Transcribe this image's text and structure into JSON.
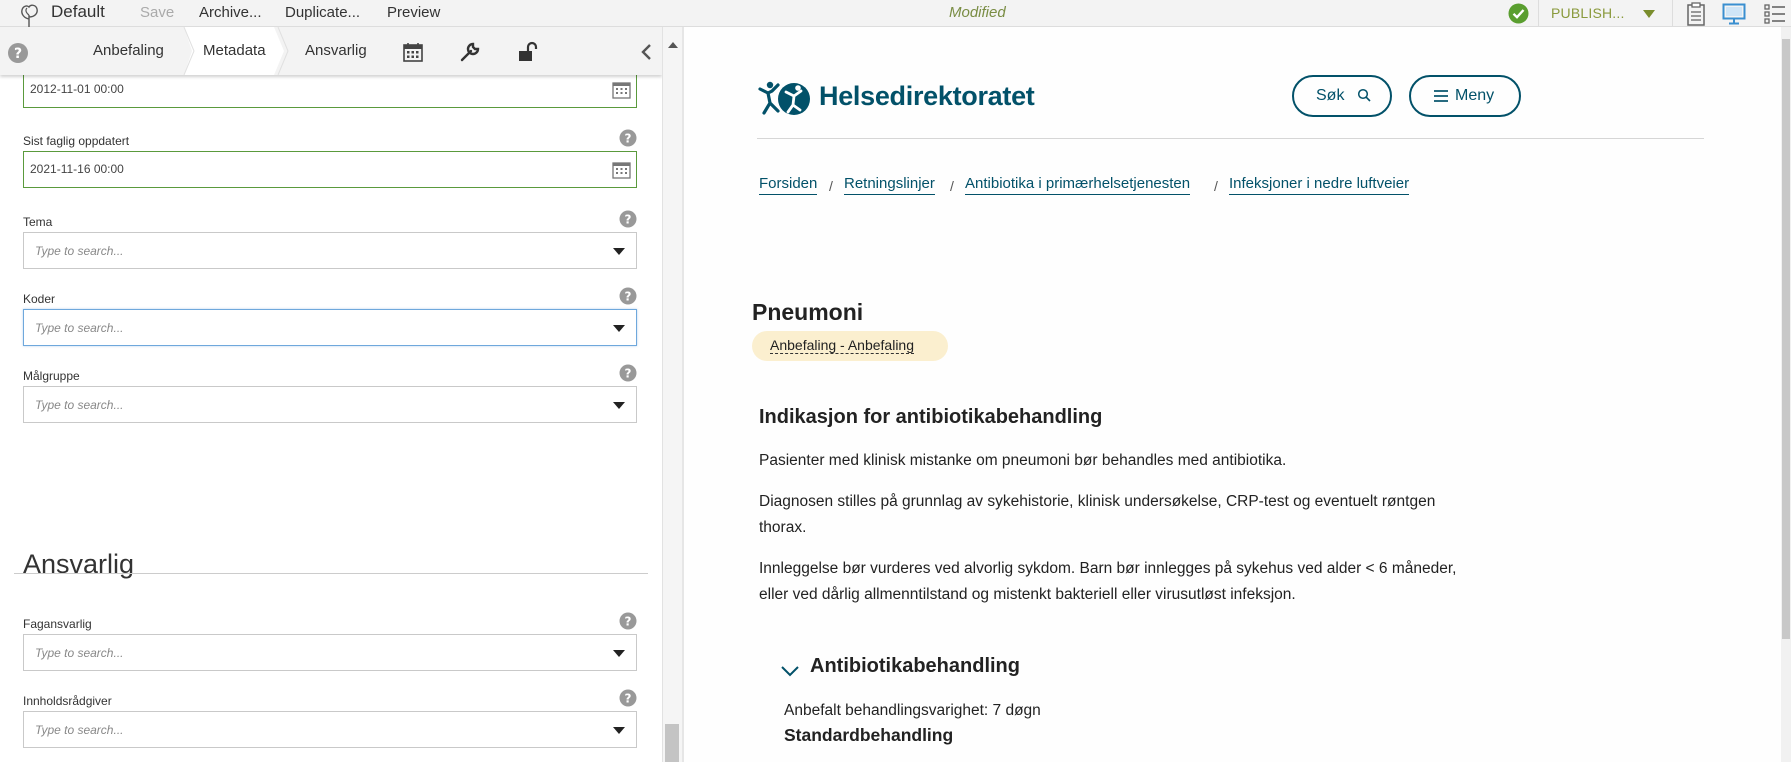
{
  "topbar": {
    "site_name": "Default",
    "save_label": "Save",
    "archive_label": "Archive...",
    "duplicate_label": "Duplicate...",
    "preview_label": "Preview",
    "status": "Modified",
    "publish_label": "PUBLISH...",
    "icons": [
      "logo-tree-icon",
      "check-circle-icon",
      "caret-down-icon",
      "clipboard-icon",
      "monitor-icon",
      "list-icon"
    ]
  },
  "tabs": {
    "items": [
      {
        "label": "Anbefaling"
      },
      {
        "label": "Metadata"
      },
      {
        "label": "Ansvarlig"
      }
    ],
    "active": "Metadata",
    "icons": [
      "help-icon",
      "calendar-icon",
      "wrench-icon",
      "unlock-icon",
      "chevron-left-icon"
    ]
  },
  "fields": {
    "date_first": {
      "value": "2012-11-01 00:00"
    },
    "sist_faglig": {
      "label": "Sist faglig oppdatert",
      "value": "2021-11-16 00:00"
    },
    "tema": {
      "label": "Tema",
      "placeholder": "Type to search..."
    },
    "koder": {
      "label": "Koder",
      "placeholder": "Type to search..."
    },
    "malgruppe": {
      "label": "Målgruppe",
      "placeholder": "Type to search..."
    },
    "section_title": "Ansvarlig",
    "fagansvarlig": {
      "label": "Fagansvarlig",
      "placeholder": "Type to search..."
    },
    "innholdsradgiver": {
      "label": "Innholdsrådgiver",
      "placeholder": "Type to search..."
    }
  },
  "preview": {
    "brand": "Helsedirektoratet",
    "brand_color": "#025169",
    "search_label": "Søk",
    "menu_label": "Meny",
    "breadcrumbs": [
      {
        "label": "Forsiden"
      },
      {
        "label": "Retningslinjer"
      },
      {
        "label": "Antibiotika i primærhelsetjenesten"
      },
      {
        "label": "Infeksjoner i nedre luftveier"
      }
    ],
    "title": "Pneumoni",
    "tag": "Anbefaling - Anbefaling",
    "tag_color": "#fbefcf",
    "h2": "Indikasjon for antibiotikabehandling",
    "paragraphs": [
      "Pasienter med klinisk mistanke om  pneumoni bør behandles med antibiotika.",
      "Diagnosen stilles på grunnlag av sykehistorie, klinisk undersøkelse, CRP-test og eventuelt røntgen thorax.",
      "Innleggelse bør vurderes ved alvorlig sykdom. Barn bør innlegges på sykehus ved alder < 6 måneder, eller ved dårlig allmenntilstand og mistenkt bakteriell eller virusutløst infeksjon."
    ],
    "accordion_title": "Antibiotikabehandling",
    "duration_line": "Anbefalt behandlingsvarighet: 7 døgn",
    "sub_heading": "Standardbehandling"
  }
}
